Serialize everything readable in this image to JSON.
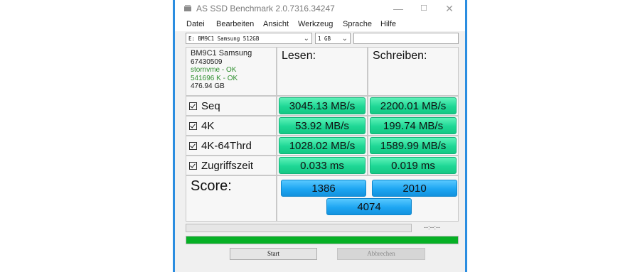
{
  "window": {
    "title": "AS SSD Benchmark 2.0.7316.34247",
    "controls": {
      "minimize": "—",
      "maximize": "☐",
      "close": "✕"
    }
  },
  "menu": [
    "Datei",
    "Bearbeiten",
    "Ansicht",
    "Werkzeug",
    "Sprache",
    "Hilfe"
  ],
  "toolbar": {
    "drive_select": "E: BM9C1 Samsung 512GB",
    "size_select": "1 GB",
    "search_value": ""
  },
  "drive_info": {
    "model": "BM9C1 Samsung",
    "serial": "67430509",
    "driver": "stornvme - OK",
    "alignment": "541696 K - OK",
    "capacity": "476.94 GB"
  },
  "headers": {
    "read": "Lesen:",
    "write": "Schreiben:"
  },
  "tests": [
    {
      "label": "Seq",
      "read": "3045.13 MB/s",
      "write": "2200.01 MB/s",
      "checked": true
    },
    {
      "label": "4K",
      "read": "53.92 MB/s",
      "write": "199.74 MB/s",
      "checked": true
    },
    {
      "label": "4K-64Thrd",
      "read": "1028.02 MB/s",
      "write": "1589.99 MB/s",
      "checked": true
    },
    {
      "label": "Zugriffszeit",
      "read": "0.033 ms",
      "write": "0.019 ms",
      "checked": true
    }
  ],
  "score": {
    "label": "Score:",
    "read": "1386",
    "write": "2010",
    "total": "4074"
  },
  "progress": {
    "elapsed": "--:--:--",
    "test_progress": 0,
    "overall_progress": 1.0
  },
  "buttons": {
    "start": "Start",
    "abort": "Abbrechen"
  },
  "colors": {
    "accent": "#2b8de0",
    "result_green": "#1ed795",
    "score_blue": "#1ea6f2",
    "progress_green": "#06b025"
  }
}
